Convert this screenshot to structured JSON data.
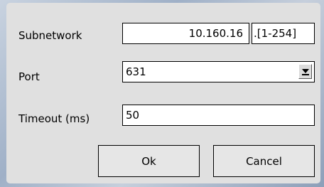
{
  "dialog": {
    "subnetwork": {
      "label": "Subnetwork",
      "value": "10.160.16",
      "suffix": ".[1-254]"
    },
    "port": {
      "label": "Port",
      "selected": "631"
    },
    "timeout": {
      "label": "Timeout (ms)",
      "value": "50"
    },
    "buttons": {
      "ok": "Ok",
      "cancel": "Cancel"
    }
  }
}
